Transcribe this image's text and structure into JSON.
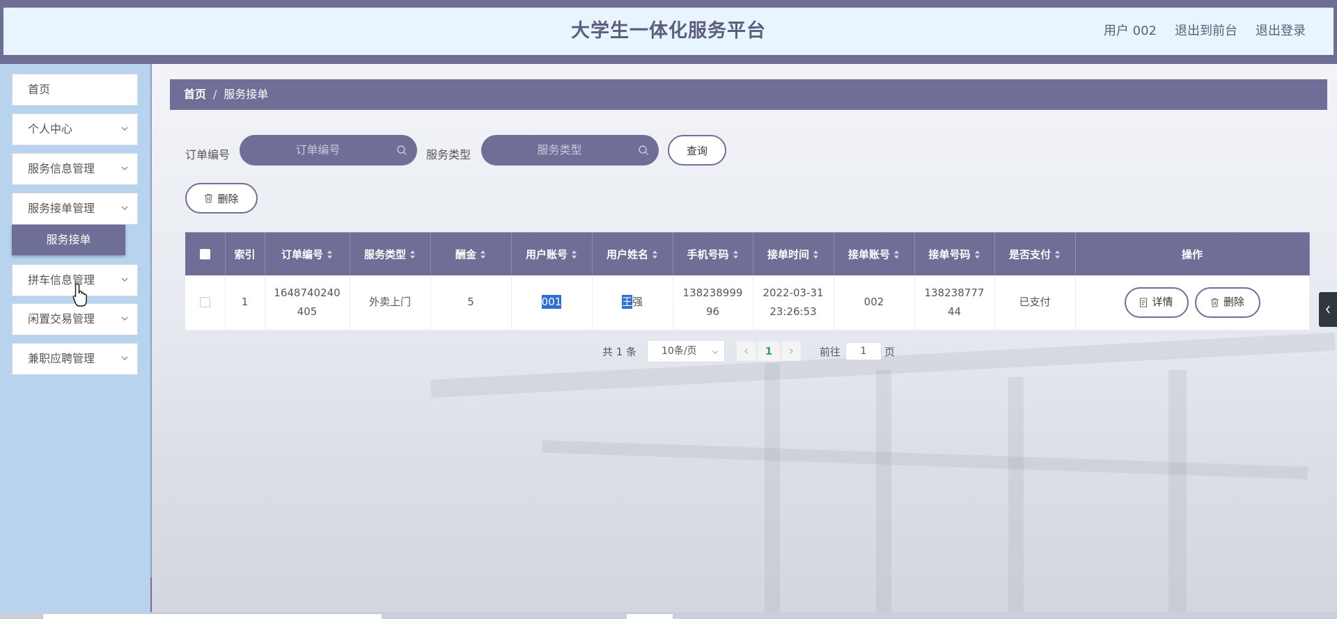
{
  "header": {
    "title": "大学生一体化服务平台",
    "user": "用户 002",
    "to_front": "退出到前台",
    "logout": "退出登录"
  },
  "sidebar": {
    "items": [
      {
        "label": "首页",
        "icon": "none"
      },
      {
        "label": "个人中心",
        "icon": "chevron-down-icon"
      },
      {
        "label": "服务信息管理",
        "icon": "chevron-down-icon"
      },
      {
        "label": "服务接单管理",
        "icon": "chevron-down-icon"
      },
      {
        "label": "拼车信息管理",
        "icon": "chevron-down-icon"
      },
      {
        "label": "闲置交易管理",
        "icon": "chevron-down-icon"
      },
      {
        "label": "兼职应聘管理",
        "icon": "chevron-down-icon"
      }
    ],
    "active_sub": "服务接单"
  },
  "breadcrumb": {
    "home": "首页",
    "sep": "/",
    "current": "服务接单"
  },
  "filters": {
    "order_no_label": "订单编号",
    "order_no_placeholder": "订单编号",
    "service_type_label": "服务类型",
    "service_type_placeholder": "服务类型",
    "query_button": "查询",
    "delete_button": "删除"
  },
  "table": {
    "columns": [
      "索引",
      "订单编号",
      "服务类型",
      "酬金",
      "用户账号",
      "用户姓名",
      "手机号码",
      "接单时间",
      "接单账号",
      "接单号码",
      "是否支付",
      "操作"
    ],
    "rows": [
      {
        "index": "1",
        "order_no": [
          "1648740240",
          "405"
        ],
        "service_type": "外卖上门",
        "fee": "5",
        "user_account": "001",
        "user_name_hl": "王",
        "user_name_rest": "强",
        "phone": [
          "138238999",
          "96"
        ],
        "accept_time": [
          "2022-03-31",
          "23:26:53"
        ],
        "accept_account": "002",
        "accept_phone": [
          "138238777",
          "44"
        ],
        "paid": "已支付",
        "detail_btn": "详情",
        "delete_btn": "删除"
      }
    ]
  },
  "pagination": {
    "total": "共 1 条",
    "page_size": "10条/页",
    "current_page": "1",
    "goto_label": "前往",
    "goto_value": "1",
    "page_unit": "页"
  },
  "colors": {
    "accent": "#6e6e96",
    "sidebar": "#b7d3ee",
    "header_bg": "#e8f4fe",
    "highlight": "#2e6fd4"
  }
}
